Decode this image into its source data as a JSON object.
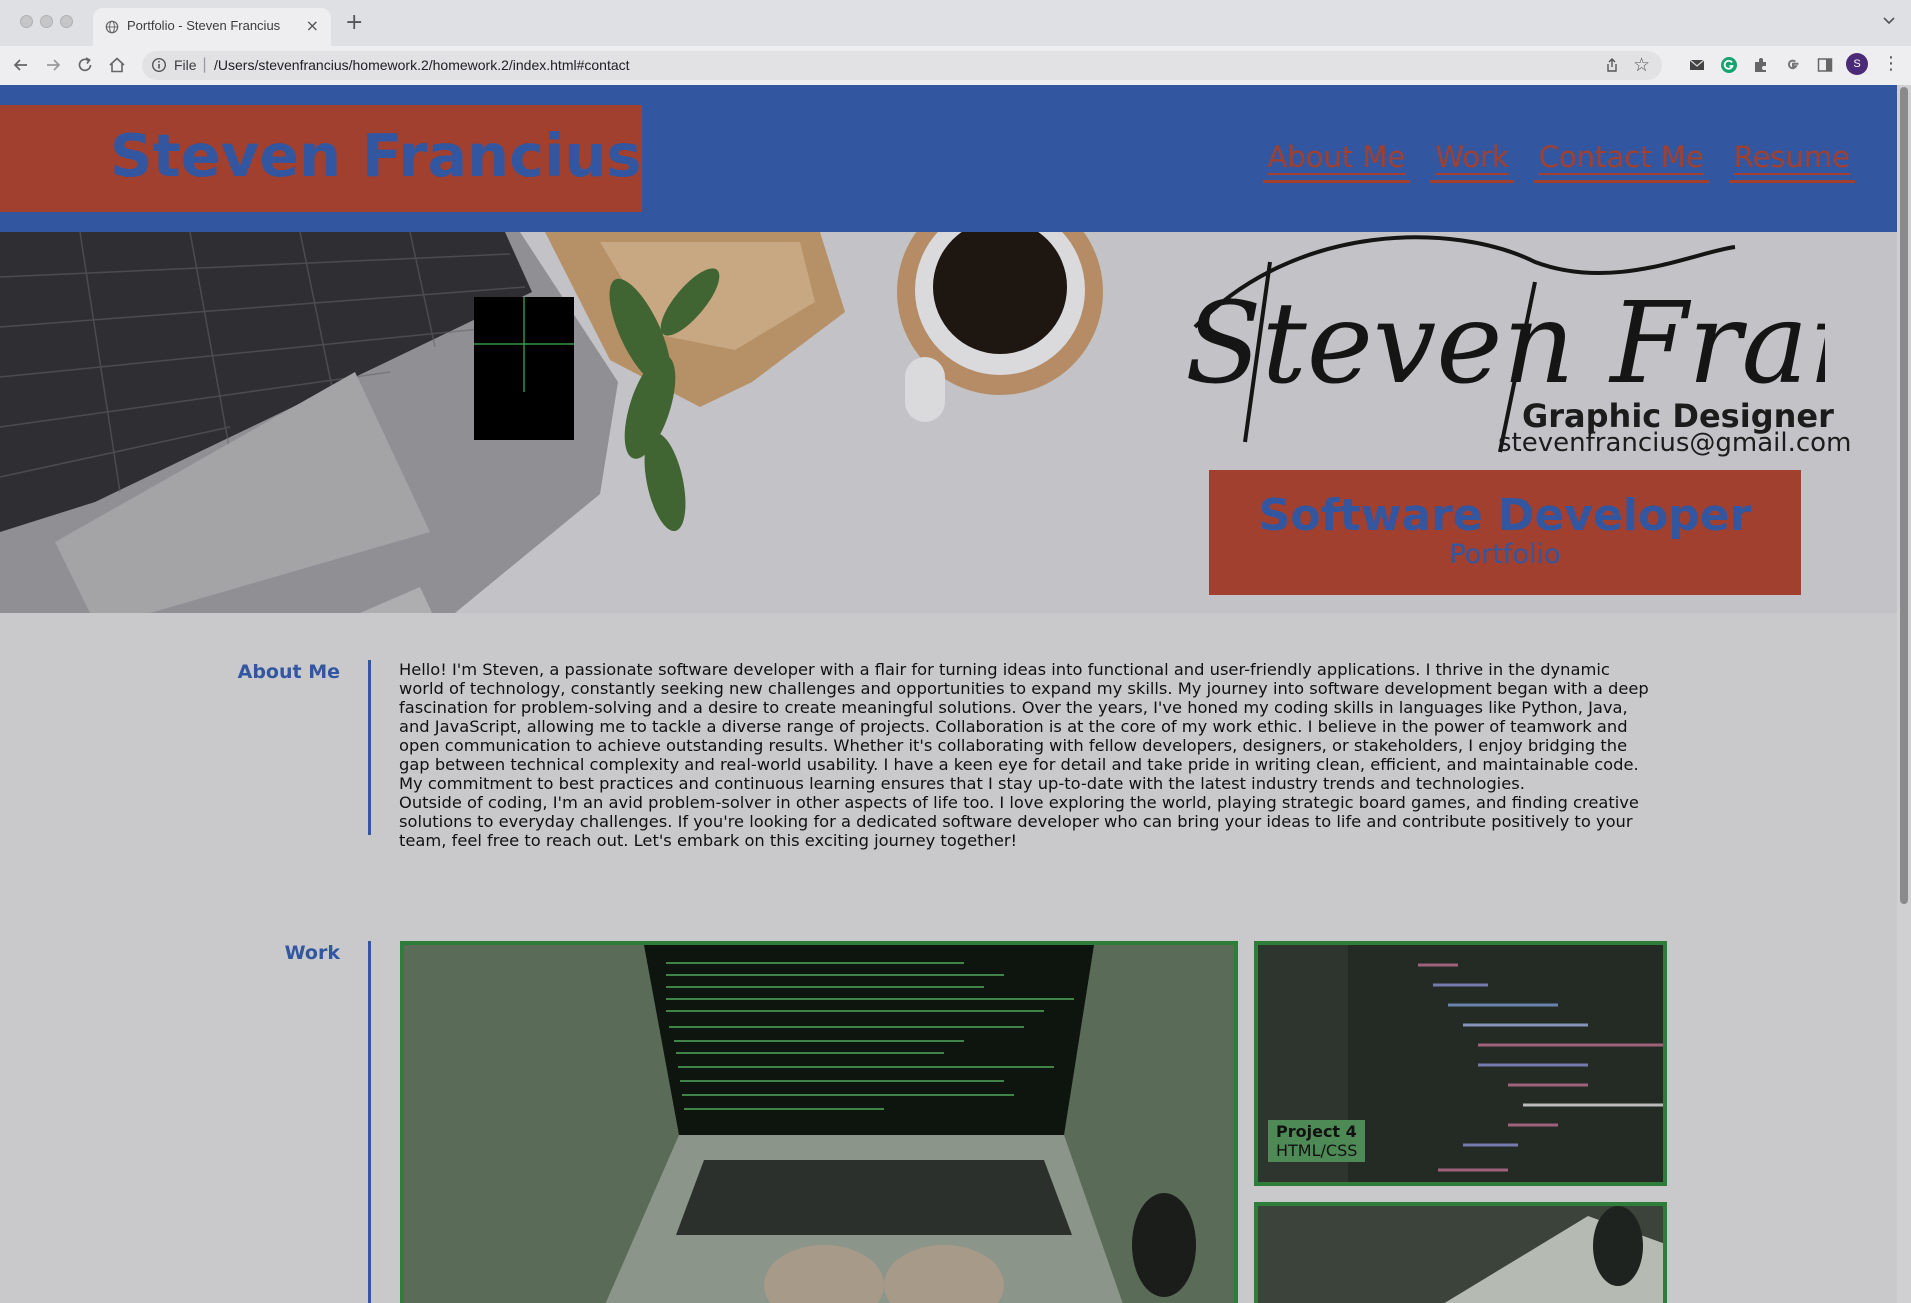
{
  "browser": {
    "tab_title": "Portfolio - Steven Francius",
    "new_tab": "+",
    "close": "×",
    "scheme_label": "File",
    "url": "/Users/stevenfrancius/homework.2/homework.2/index.html#contact",
    "profile_initial": "S"
  },
  "header": {
    "brand": "Steven Francius",
    "nav": [
      "About Me",
      "Work",
      "Contact Me",
      "Resume"
    ]
  },
  "hero": {
    "signature": "Steven Francius",
    "role": "Graphic Designer",
    "email": "stevenfrancius@gmail.com",
    "title": "Software Developer",
    "subtitle": "Portfolio"
  },
  "about": {
    "label": "About Me",
    "paragraphs": [
      "Hello! I'm Steven, a passionate software developer with a flair for turning ideas into functional and user-friendly applications. I thrive in the dynamic world of technology, constantly seeking new challenges and opportunities to expand my skills. My journey into software development began with a deep fascination for problem-solving and a desire to create meaningful solutions. Over the years, I've honed my coding skills in languages like Python, Java, and JavaScript, allowing me to tackle a diverse range of projects. Collaboration is at the core of my work ethic. I believe in the power of teamwork and open communication to achieve outstanding results. Whether it's collaborating with fellow developers, designers, or stakeholders, I enjoy bridging the gap between technical complexity and real-world usability. I have a keen eye for detail and take pride in writing clean, efficient, and maintainable code. My commitment to best practices and continuous learning ensures that I stay up-to-date with the latest industry trends and technologies.",
      "Outside of coding, I'm an avid problem-solver in other aspects of life too. I love exploring the world, playing strategic board games, and finding creative solutions to everyday challenges. If you're looking for a dedicated software developer who can bring your ideas to life and contribute positively to your team, feel free to reach out. Let's embark on this exciting journey together!"
    ]
  },
  "work": {
    "label": "Work",
    "projects": [
      {
        "name": "Project 4",
        "tech": "HTML/CSS"
      }
    ]
  },
  "colors": {
    "brand_blue": "#3356a0",
    "brand_red": "#a1402f",
    "work_green": "#2f7d3b"
  }
}
